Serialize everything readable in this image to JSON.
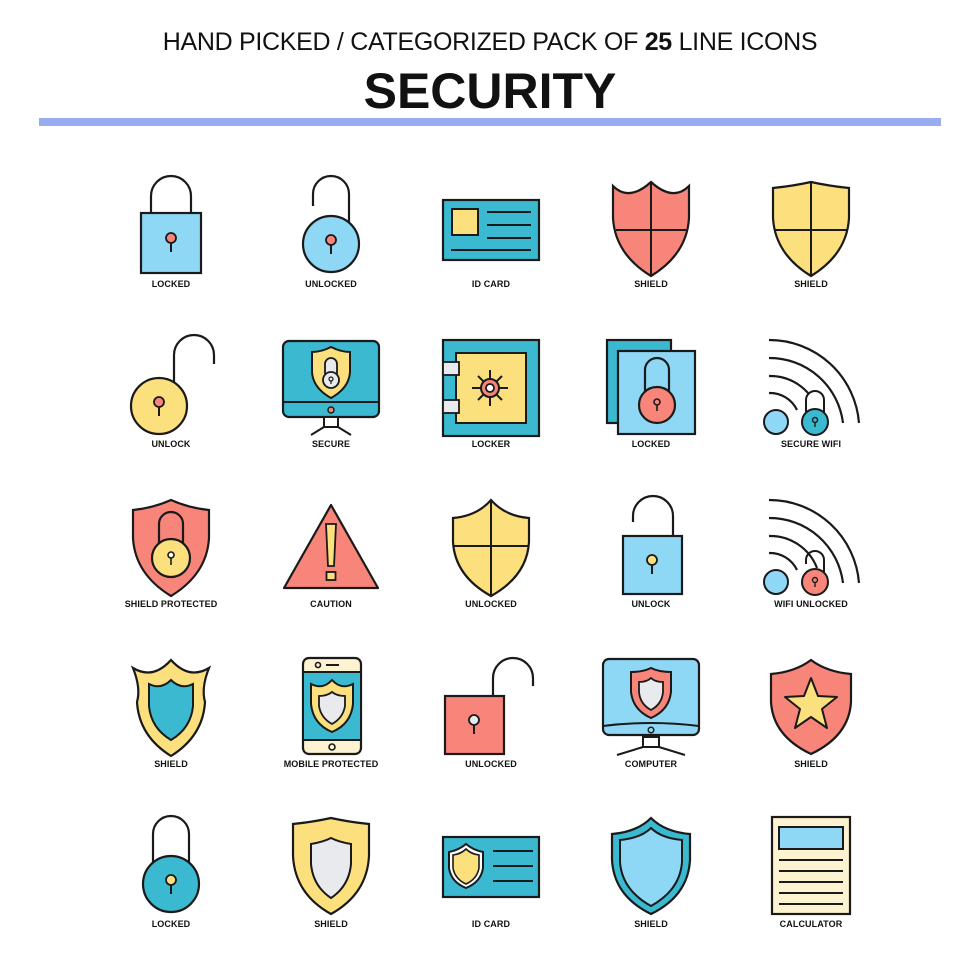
{
  "header": {
    "subtitle_prefix": "HAND PICKED / CATEGORIZED PACK OF ",
    "subtitle_count": "25",
    "subtitle_suffix": " LINE ICONS",
    "title": "SECURITY"
  },
  "colors": {
    "divider": "#98acf2",
    "light_blue": "#8fd8f5",
    "teal": "#3ab9d0",
    "coral": "#f7857a",
    "yellow": "#fde07e",
    "light_gray": "#e8eaee",
    "cream": "#fdf3d0",
    "outline": "#1a1a1a"
  },
  "icons": [
    {
      "label": "LOCKED",
      "icon": "padlock-locked-icon"
    },
    {
      "label": "UNLOCKED",
      "icon": "padlock-round-open-icon"
    },
    {
      "label": "ID CARD",
      "icon": "id-card-icon"
    },
    {
      "label": "SHIELD",
      "icon": "shield-cross-coral-icon"
    },
    {
      "label": "SHIELD",
      "icon": "shield-cross-yellow-icon"
    },
    {
      "label": "UNLOCK",
      "icon": "padlock-round-open-yellow-icon"
    },
    {
      "label": "SECURE",
      "icon": "monitor-shield-lock-icon"
    },
    {
      "label": "LOCKER",
      "icon": "safe-vault-icon"
    },
    {
      "label": "LOCKED",
      "icon": "documents-lock-icon"
    },
    {
      "label": "SECURE WIFI",
      "icon": "wifi-lock-icon"
    },
    {
      "label": "SHIELD PROTECTED",
      "icon": "shield-lock-icon"
    },
    {
      "label": "CAUTION",
      "icon": "warning-triangle-icon"
    },
    {
      "label": "UNLOCKED",
      "icon": "shield-cross-yellow-icon"
    },
    {
      "label": "UNLOCK",
      "icon": "padlock-open-icon"
    },
    {
      "label": "WIFI UNLOCKED",
      "icon": "wifi-lock-open-icon"
    },
    {
      "label": "SHIELD",
      "icon": "shield-crest-icon"
    },
    {
      "label": "MOBILE PROTECTED",
      "icon": "mobile-shield-icon"
    },
    {
      "label": "UNLOCKED",
      "icon": "padlock-open-coral-icon"
    },
    {
      "label": "COMPUTER",
      "icon": "monitor-shield-icon"
    },
    {
      "label": "SHIELD",
      "icon": "shield-star-icon"
    },
    {
      "label": "LOCKED",
      "icon": "padlock-round-locked-icon"
    },
    {
      "label": "SHIELD",
      "icon": "shield-yellow-gray-icon"
    },
    {
      "label": "ID CARD",
      "icon": "id-card-shield-icon"
    },
    {
      "label": "SHIELD",
      "icon": "shield-blue-icon"
    },
    {
      "label": "CALCULATOR",
      "icon": "document-calculator-icon"
    }
  ]
}
